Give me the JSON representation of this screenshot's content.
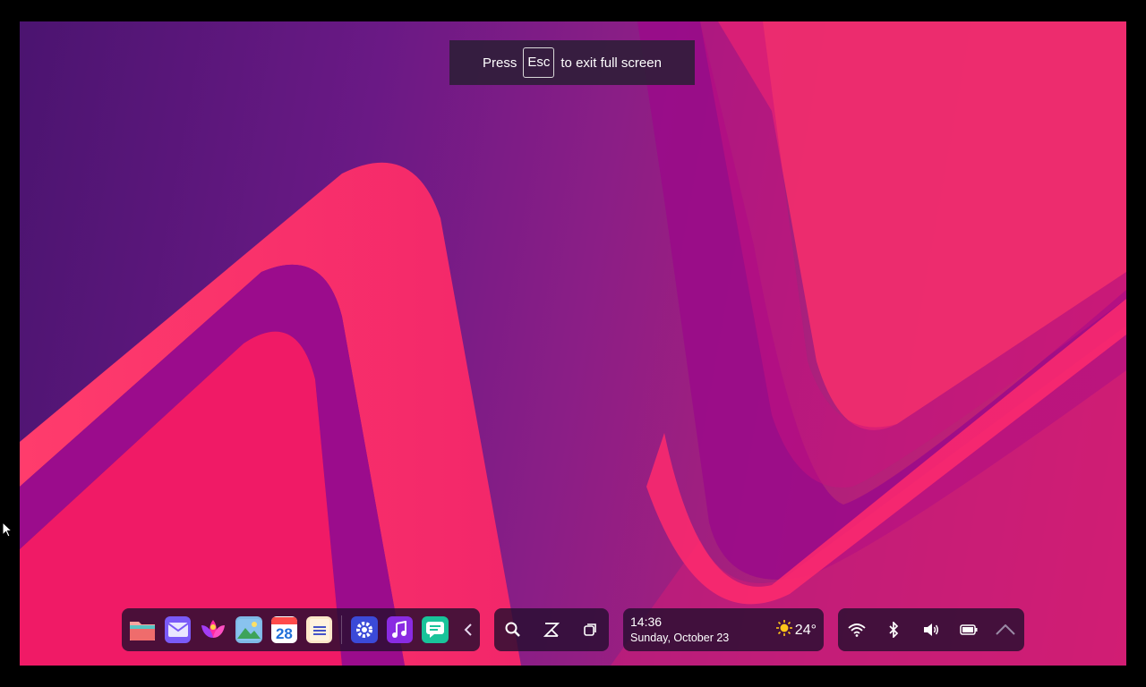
{
  "fullscreen_banner": {
    "prefix": "Press",
    "key": "Esc",
    "suffix": "to exit full screen"
  },
  "taskbar": {
    "apps": [
      {
        "name": "files-app-icon"
      },
      {
        "name": "mail-app-icon"
      },
      {
        "name": "lotus-app-icon"
      },
      {
        "name": "photos-app-icon"
      },
      {
        "name": "calendar-app-icon",
        "text": "28"
      },
      {
        "name": "notes-app-icon"
      },
      {
        "name": "settings-app-icon"
      },
      {
        "name": "music-app-icon"
      },
      {
        "name": "chat-app-icon"
      }
    ],
    "clock": {
      "time": "14:36",
      "date": "Sunday, October 23"
    },
    "weather": {
      "temp": "24°",
      "icon": "sun-icon"
    },
    "tray": [
      "wifi-icon",
      "bluetooth-icon",
      "volume-icon",
      "battery-icon",
      "chevron-up-icon"
    ]
  },
  "colors": {
    "accent": "#ff2a6d",
    "taskbar_bg": "#260e30"
  }
}
